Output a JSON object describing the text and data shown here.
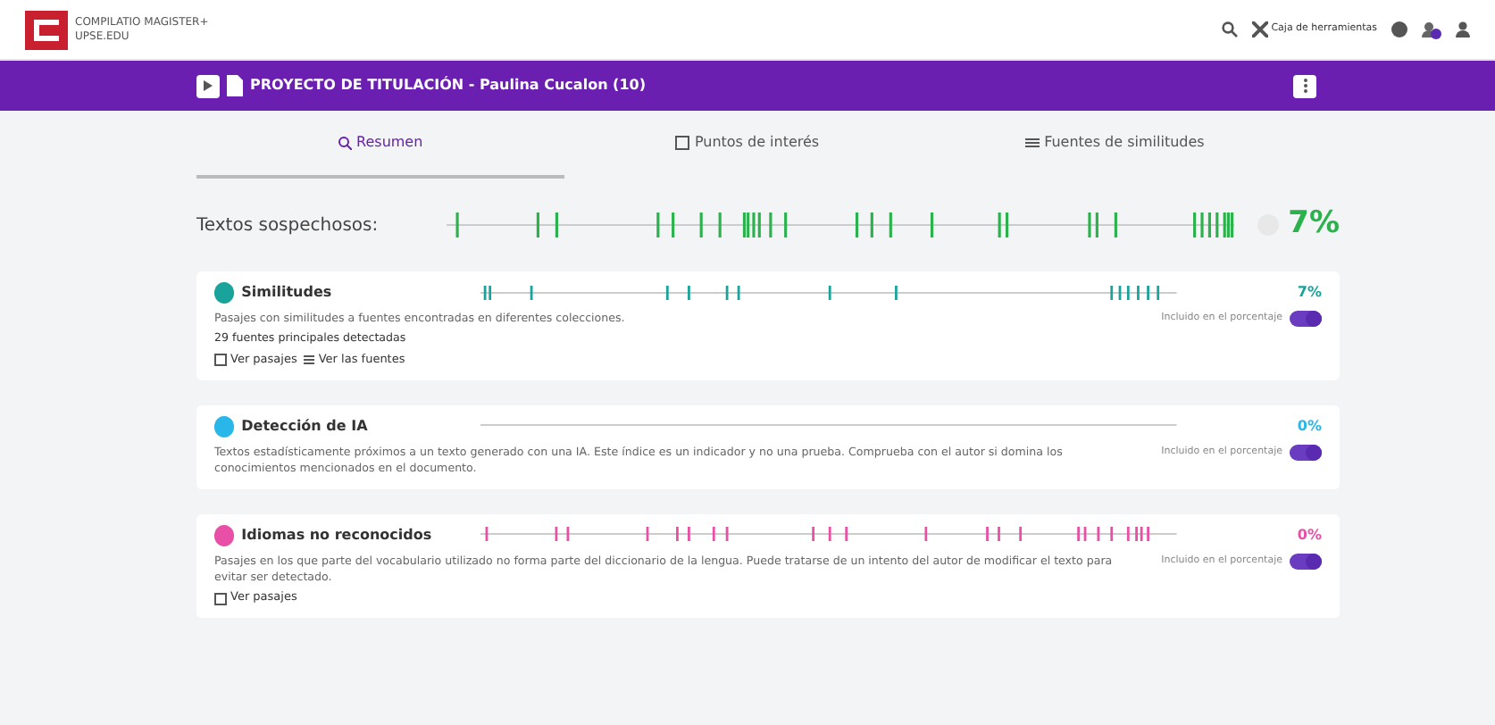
{
  "header": {
    "brand_line_1": "COMPILATIO MAGISTER+",
    "brand_line_2": "UPSE.EDU",
    "toolbox": "Caja de herramientas"
  },
  "doc_bar": {
    "title": "PROYECTO DE TITULACIÓN - Paulina Cucalon (10)"
  },
  "tabs": [
    {
      "label": "Resumen",
      "selected": true
    },
    {
      "label": "Puntos de interés",
      "selected": false
    },
    {
      "label": "Fuentes de similitudes",
      "selected": false
    }
  ],
  "summary": {
    "label": "Textos sospechosos:",
    "percent": "7%"
  },
  "cards": [
    {
      "title": "Similitudes",
      "percent": "7%",
      "color": "#1aa39a",
      "description": "Pasajes con similitudes a fuentes encontradas en diferentes colecciones.",
      "toggle_label": "Incluido en el porcentaje",
      "included": true,
      "sources": "29 fuentes principales detectadas",
      "links": [
        "Ver pasajes",
        "Ver las fuentes"
      ]
    },
    {
      "title": "Detección de IA",
      "percent": "0%",
      "color": "#29b6e8",
      "description": "Textos estadísticamente próximos a un texto generado con una IA. Este índice es un indicador y no una prueba. Comprueba con el autor si domina los conocimientos mencionados en el documento.",
      "toggle_label": "Incluido en el porcentaje",
      "included": true
    },
    {
      "title": "Idiomas no reconocidos",
      "percent": "0%",
      "color": "#e84fa6",
      "description": "Pasajes en los que parte del vocabulario utilizado no forma parte del diccionario de la lengua. Puede tratarse de un intento del autor de modificar el texto para evitar ser detectado.",
      "toggle_label": "Incluido en el porcentaje",
      "included": true,
      "links": [
        "Ver pasajes"
      ]
    }
  ]
}
